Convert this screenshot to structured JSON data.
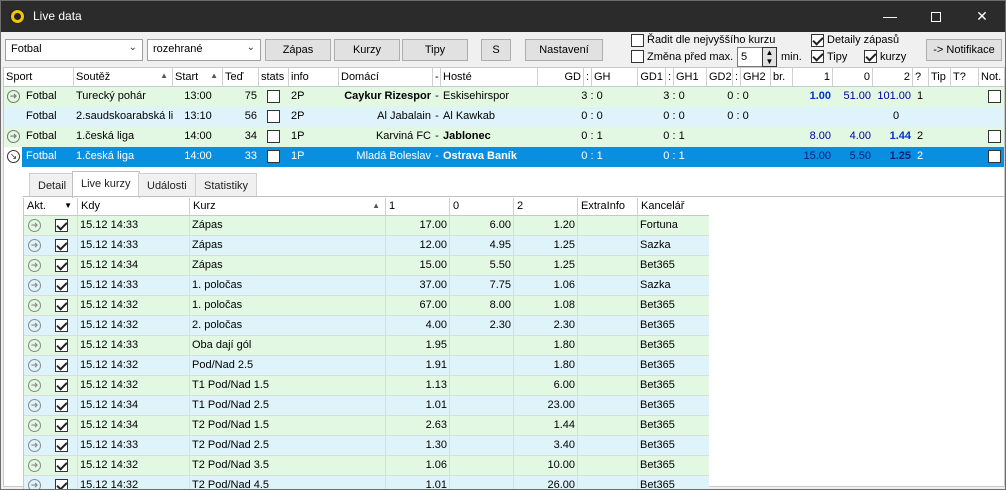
{
  "window": {
    "title": "Live data"
  },
  "toolbar": {
    "sport_select": "Fotbal",
    "state_select": "rozehrané",
    "btn_zapas": "Zápas",
    "btn_kurzy": "Kurzy",
    "btn_tipy": "Tipy",
    "btn_s": "S",
    "btn_nastaveni": "Nastavení",
    "opt_radit": "Řadit dle nejvyššího kurzu",
    "opt_zmena": "Změna před max.",
    "zmena_value": "5",
    "zmena_unit": "min.",
    "opt_detaily": "Detaily zápasů",
    "opt_tipy": "Tipy",
    "opt_kurzy": "kurzy",
    "btn_notifikace": "-> Notifikace"
  },
  "main_grid": {
    "headers": [
      "Sport",
      "Soutěž",
      "Start",
      "Teď",
      "stats",
      "info",
      "Domácí",
      "-",
      "Hosté",
      "GD",
      ":",
      "GH",
      "GD1",
      ":",
      "GH1",
      "GD2",
      ":",
      "GH2",
      "br.",
      "1",
      "0",
      "2",
      "?",
      "Tip",
      "T?",
      "Not."
    ],
    "rows": [
      {
        "sport": "Fotbal",
        "soutez": "Turecký pohár",
        "start": "13:00",
        "ted": "75",
        "info": "2P",
        "domaci": "Caykur Rizespor",
        "sep": "-",
        "hoste": "Eskisehirspor",
        "gd": "3 : 0",
        "gd1": "3 : 0",
        "gd2": "0 : 0",
        "k1": "1.00",
        "k0": "51.00",
        "k2": "101.00",
        "q": "1"
      },
      {
        "sport": "Fotbal",
        "soutez": "2.saudskoarabská liga",
        "start": "13:10",
        "ted": "56",
        "info": "2P",
        "domaci": "Al Jabalain",
        "sep": "-",
        "hoste": "Al Kawkab",
        "gd": "0 : 0",
        "gd1": "0 : 0",
        "gd2": "0 : 0",
        "k1": "",
        "k0": "",
        "k2": "",
        "q": "0"
      },
      {
        "sport": "Fotbal",
        "soutez": "1.česká liga",
        "start": "14:00",
        "ted": "34",
        "info": "1P",
        "domaci": "Karviná FC",
        "sep": "-",
        "hoste": "Jablonec",
        "gd": "0 : 1",
        "gd1": "0 : 1",
        "gd2": "",
        "k1": "8.00",
        "k0": "4.00",
        "k2": "1.44",
        "q": "2"
      },
      {
        "sport": "Fotbal",
        "soutez": "1.česká liga",
        "start": "14:00",
        "ted": "33",
        "info": "1P",
        "domaci": "Mladá Boleslav",
        "sep": "-",
        "hoste": "Ostrava Baník",
        "gd": "0 : 1",
        "gd1": "0 : 1",
        "gd2": "",
        "k1": "15.00",
        "k0": "5.50",
        "k2": "1.25",
        "q": "2"
      }
    ]
  },
  "tabs": [
    "Detail",
    "Live kurzy",
    "Události",
    "Statistiky"
  ],
  "odds_grid": {
    "headers": [
      "Akt.",
      "Kdy",
      "Kurz",
      "1",
      "0",
      "2",
      "ExtraInfo",
      "Kancelář"
    ],
    "rows": [
      {
        "kdy": "15.12 14:33",
        "kurz": "Zápas",
        "v1": "17.00",
        "v0": "6.00",
        "v2": "1.20",
        "kancelar": "Fortuna"
      },
      {
        "kdy": "15.12 14:33",
        "kurz": "Zápas",
        "v1": "12.00",
        "v0": "4.95",
        "v2": "1.25",
        "kancelar": "Sazka"
      },
      {
        "kdy": "15.12 14:34",
        "kurz": "Zápas",
        "v1": "15.00",
        "v0": "5.50",
        "v2": "1.25",
        "kancelar": "Bet365"
      },
      {
        "kdy": "15.12 14:33",
        "kurz": "1. poločas",
        "v1": "37.00",
        "v0": "7.75",
        "v2": "1.06",
        "kancelar": "Sazka"
      },
      {
        "kdy": "15.12 14:32",
        "kurz": "1. poločas",
        "v1": "67.00",
        "v0": "8.00",
        "v2": "1.08",
        "kancelar": "Bet365"
      },
      {
        "kdy": "15.12 14:32",
        "kurz": "2. poločas",
        "v1": "4.00",
        "v0": "2.30",
        "v2": "2.30",
        "kancelar": "Bet365"
      },
      {
        "kdy": "15.12 14:33",
        "kurz": "Oba dají gól",
        "v1": "1.95",
        "v0": "",
        "v2": "1.80",
        "kancelar": "Bet365"
      },
      {
        "kdy": "15.12 14:32",
        "kurz": "Pod/Nad 2.5",
        "v1": "1.91",
        "v0": "",
        "v2": "1.80",
        "kancelar": "Bet365"
      },
      {
        "kdy": "15.12 14:32",
        "kurz": "T1 Pod/Nad 1.5",
        "v1": "1.13",
        "v0": "",
        "v2": "6.00",
        "kancelar": "Bet365"
      },
      {
        "kdy": "15.12 14:34",
        "kurz": "T1 Pod/Nad 2.5",
        "v1": "1.01",
        "v0": "",
        "v2": "23.00",
        "kancelar": "Bet365"
      },
      {
        "kdy": "15.12 14:34",
        "kurz": "T2 Pod/Nad 1.5",
        "v1": "2.63",
        "v0": "",
        "v2": "1.44",
        "kancelar": "Bet365"
      },
      {
        "kdy": "15.12 14:33",
        "kurz": "T2 Pod/Nad 2.5",
        "v1": "1.30",
        "v0": "",
        "v2": "3.40",
        "kancelar": "Bet365"
      },
      {
        "kdy": "15.12 14:32",
        "kurz": "T2 Pod/Nad 3.5",
        "v1": "1.06",
        "v0": "",
        "v2": "10.00",
        "kancelar": "Bet365"
      },
      {
        "kdy": "15.12 14:32",
        "kurz": "T2 Pod/Nad 4.5",
        "v1": "1.01",
        "v0": "",
        "v2": "26.00",
        "kancelar": "Bet365"
      }
    ]
  },
  "colors": {
    "green_row": "#e2f8e2",
    "blue_row": "#dff3fb",
    "selected_row": "#0a8ee0",
    "odds_blue": "#0033cc"
  }
}
